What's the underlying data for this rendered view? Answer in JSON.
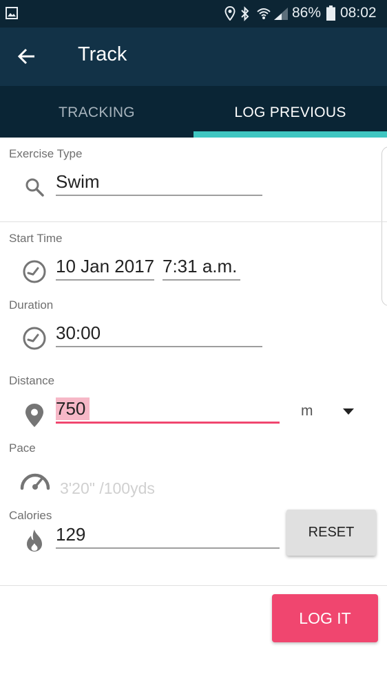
{
  "status_bar": {
    "battery": "86%",
    "time": "08:02",
    "icons": [
      "image-icon",
      "location-icon",
      "bluetooth-icon",
      "wifi-icon",
      "signal-icon",
      "battery-icon"
    ]
  },
  "app_bar": {
    "title": "Track",
    "back_icon": "arrow-back-icon"
  },
  "tabs": [
    {
      "label": "TRACKING",
      "selected": false
    },
    {
      "label": "LOG PREVIOUS",
      "selected": true
    }
  ],
  "form": {
    "exercise_type": {
      "label": "Exercise Type",
      "value": "Swim"
    },
    "start_time": {
      "label": "Start Time",
      "date": "10 Jan 2017",
      "time": "7:31 a.m."
    },
    "duration": {
      "label": "Duration",
      "value": "30:00"
    },
    "distance": {
      "label": "Distance",
      "value": "750",
      "unit": "m"
    },
    "pace": {
      "label": "Pace",
      "value": "3'20\" /100yds"
    },
    "calories": {
      "label": "Calories",
      "value": "129"
    }
  },
  "buttons": {
    "reset": "RESET",
    "log_it": "LOG IT"
  },
  "colors": {
    "status_bar": "#0c2534",
    "app_bar": "#123247",
    "tab_bar": "#0a2535",
    "tab_indicator": "#3fc6c1",
    "accent_pink": "#f0466f",
    "highlight": "#f6b8c7"
  }
}
